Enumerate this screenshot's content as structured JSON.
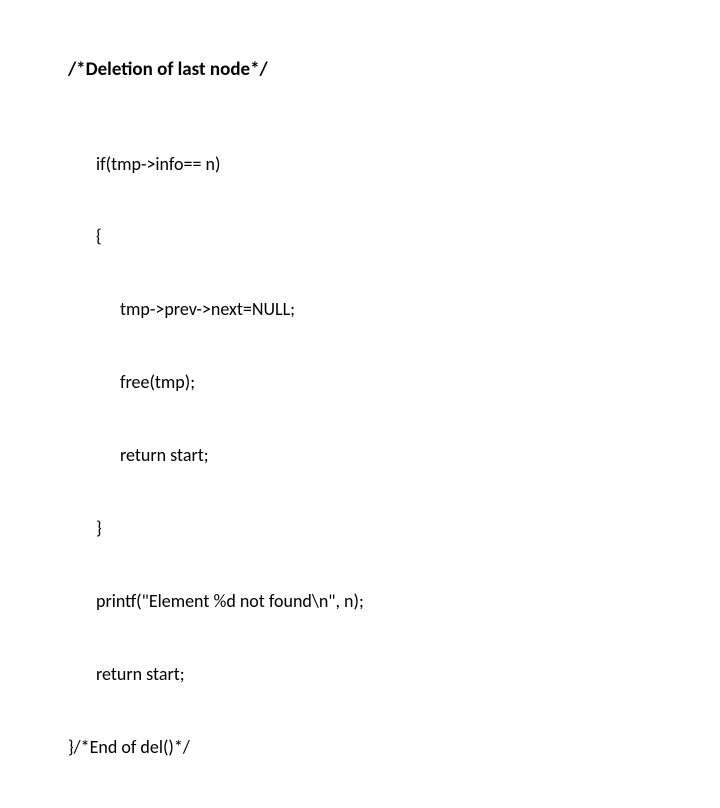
{
  "title": "/*Deletion of last node*/",
  "code": {
    "l1": "if(tmp->info== n)",
    "l2": "{",
    "l3": "tmp->prev->next=NULL;",
    "l4": "free(tmp);",
    "l5": "return start;",
    "l6": "}",
    "l7": "printf(\"Element %d not found\\n\", n);",
    "l8": "return start;",
    "l9": "}/*End of del()*/"
  }
}
